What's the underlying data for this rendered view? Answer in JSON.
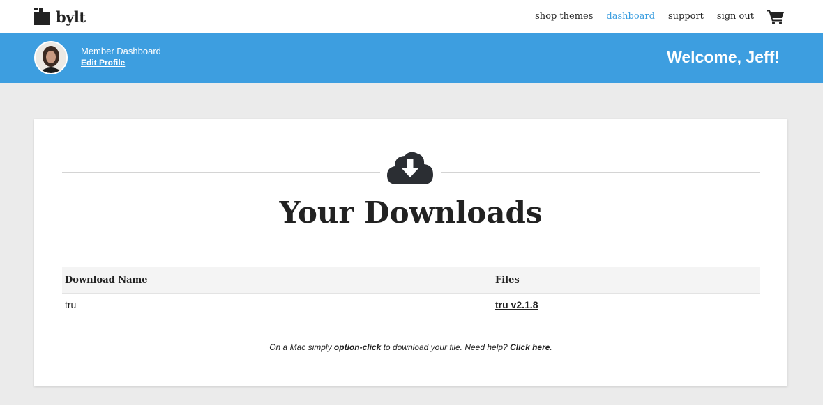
{
  "brand": {
    "name": "bylt"
  },
  "nav": {
    "items": [
      {
        "label": "shop themes",
        "active": false
      },
      {
        "label": "dashboard",
        "active": true
      },
      {
        "label": "support",
        "active": false
      },
      {
        "label": "sign out",
        "active": false
      }
    ],
    "cart_icon": "shopping-cart-icon",
    "active_color": "#3b9ee0"
  },
  "banner": {
    "title": "Member Dashboard",
    "edit_link": "Edit Profile",
    "welcome": "Welcome, Jeff!",
    "color": "#3d9ee0"
  },
  "downloads": {
    "icon": "cloud-download-icon",
    "heading": "Your Downloads",
    "columns": [
      "Download Name",
      "Files"
    ],
    "rows": [
      {
        "name": "tru",
        "file": "tru v2.1.8"
      }
    ],
    "note": {
      "prefix": "On a Mac simply ",
      "bold": "option-click",
      "middle": " to download your file. Need help? ",
      "link": "Click here",
      "suffix": "."
    }
  }
}
